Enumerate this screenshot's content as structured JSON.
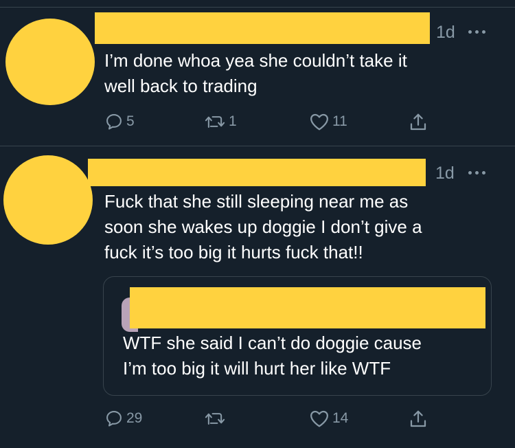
{
  "tweet1": {
    "time": "1d",
    "text_lines": [
      "I’m done whoa yea she couldn’t take it",
      "well back to trading"
    ],
    "replies": "5",
    "retweets": "1",
    "likes": "11"
  },
  "tweet2": {
    "time": "1d",
    "text_lines": [
      "Fuck that she still sleeping near me as",
      "soon she wakes up doggie I don’t give a",
      "fuck it’s too big it hurts fuck that!!"
    ],
    "quote": {
      "text_lines": [
        "WTF she said I can’t do doggie cause",
        "I’m too big it will hurt her like WTF"
      ]
    },
    "replies": "29",
    "retweets": "",
    "likes": "14"
  },
  "colors": {
    "background": "#15202b",
    "redaction": "#ffd23f",
    "muted": "#8899a6",
    "divider": "#38444d"
  },
  "icons": [
    "reply-icon",
    "retweet-icon",
    "like-icon",
    "share-icon",
    "more-icon"
  ]
}
